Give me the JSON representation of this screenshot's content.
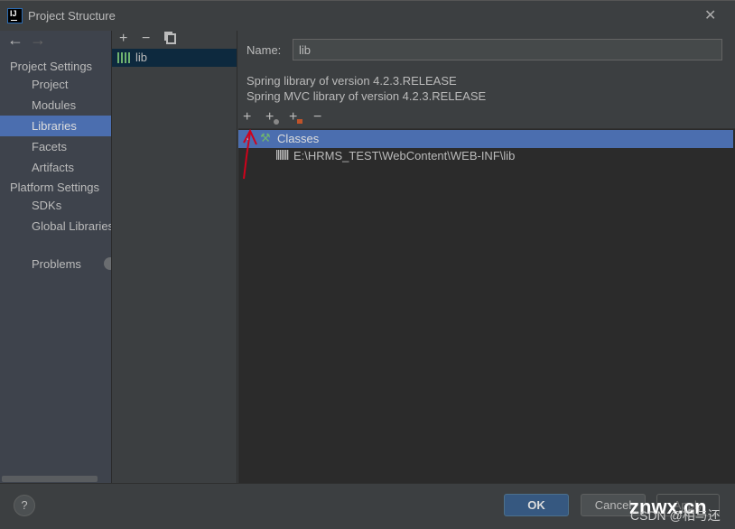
{
  "window": {
    "title": "Project Structure",
    "logo": "IJ"
  },
  "nav": {
    "back": "←",
    "forward": "→"
  },
  "sidebar": {
    "project_settings": "Project Settings",
    "items1": [
      {
        "label": "Project"
      },
      {
        "label": "Modules"
      },
      {
        "label": "Libraries",
        "selected": true
      },
      {
        "label": "Facets"
      },
      {
        "label": "Artifacts"
      }
    ],
    "platform_settings": "Platform Settings",
    "items2": [
      {
        "label": "SDKs"
      },
      {
        "label": "Global Libraries"
      }
    ],
    "problems": "Problems"
  },
  "libraries": {
    "toolbar": [
      "+",
      "−"
    ],
    "items": [
      {
        "label": "lib",
        "selected": true
      }
    ]
  },
  "detail": {
    "name_label": "Name:",
    "name_value": "lib",
    "descriptions": [
      "Spring library of version 4.2.3.RELEASE",
      "Spring MVC library of version 4.2.3.RELEASE"
    ],
    "toolbar": [
      "+",
      "+",
      "+",
      "−"
    ],
    "tree": {
      "root": "Classes",
      "children": [
        "E:\\HRMS_TEST\\WebContent\\WEB-INF\\lib"
      ]
    }
  },
  "buttons": {
    "help": "?",
    "ok": "OK",
    "cancel": "Cancel",
    "apply": "Apply"
  },
  "watermark": {
    "site": "znwx.cn",
    "credit": "CSDN @相与还"
  },
  "colors": {
    "selection": "#4b6eaf",
    "ok": "#365880",
    "annotation": "#d0021b"
  }
}
